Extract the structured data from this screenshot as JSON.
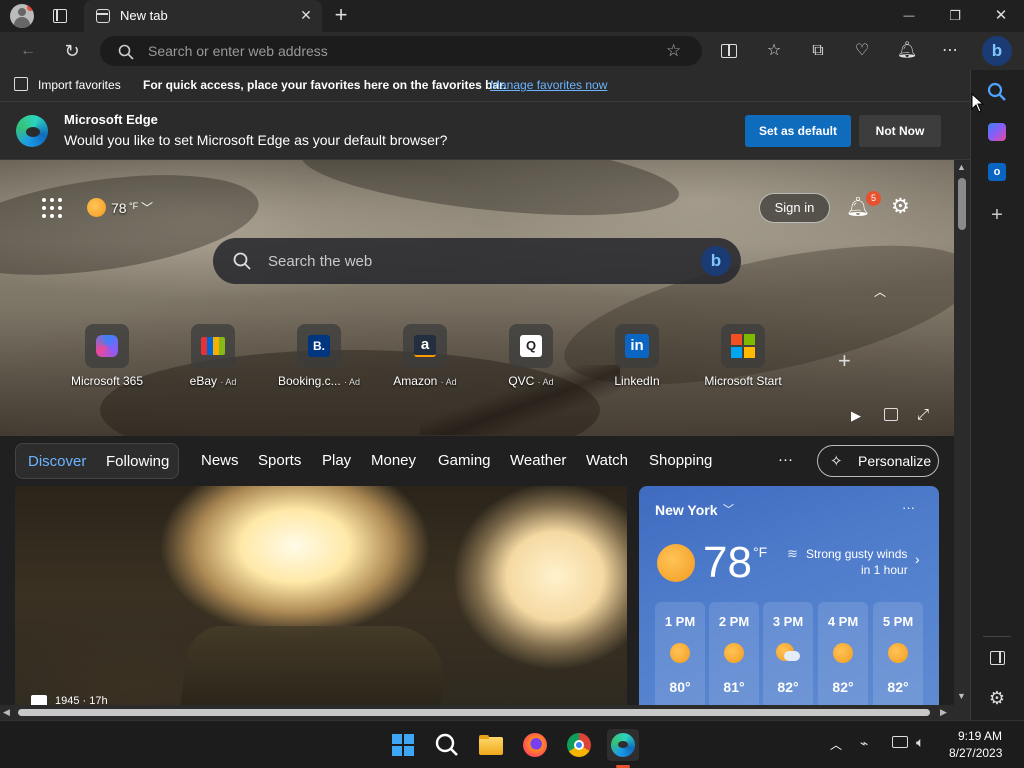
{
  "titlebar": {
    "tab_title": "New tab",
    "tab_close": "✕",
    "new_tab": "+",
    "minimize": "—",
    "maximize": "❐",
    "close": "✕"
  },
  "addressbar": {
    "placeholder": "Search or enter web address"
  },
  "favbar": {
    "import": "Import favorites",
    "message": "For quick access, place your favorites here on the favorites bar.",
    "manage_link": "Manage favorites now"
  },
  "infobar": {
    "title": "Microsoft Edge",
    "question": "Would you like to set Microsoft Edge as your default browser?",
    "set_default": "Set as default",
    "not_now": "Not Now"
  },
  "hero": {
    "weather_temp": "78",
    "weather_unit": "°F",
    "sign_in": "Sign in",
    "notif_count": "5",
    "search_placeholder": "Search the web",
    "quicklinks": [
      {
        "label": "Microsoft 365",
        "ad": ""
      },
      {
        "label": "eBay",
        "ad": "· Ad"
      },
      {
        "label": "Booking.c...",
        "ad": "· Ad"
      },
      {
        "label": "Amazon",
        "ad": "· Ad"
      },
      {
        "label": "QVC",
        "ad": "· Ad"
      },
      {
        "label": "LinkedIn",
        "ad": ""
      },
      {
        "label": "Microsoft Start",
        "ad": ""
      }
    ],
    "tile_glyphs": [
      "B.",
      "a",
      "Q",
      "in"
    ]
  },
  "feednav": {
    "discover": "Discover",
    "following": "Following",
    "items": [
      "News",
      "Sports",
      "Play",
      "Money",
      "Gaming",
      "Weather",
      "Watch",
      "Shopping"
    ],
    "more": "···",
    "personalize": "Personalize"
  },
  "news": {
    "source_time": "1945 · 17h"
  },
  "weather_card": {
    "city": "New York",
    "temp": "78",
    "unit": "°F",
    "alert_line1": "Strong gusty winds",
    "alert_line2": "in 1 hour",
    "more": "···",
    "hours": [
      {
        "time": "1 PM",
        "temp": "80°",
        "icon": "sun"
      },
      {
        "time": "2 PM",
        "temp": "81°",
        "icon": "sun"
      },
      {
        "time": "3 PM",
        "temp": "82°",
        "icon": "partly-cloudy"
      },
      {
        "time": "4 PM",
        "temp": "82°",
        "icon": "sun"
      },
      {
        "time": "5 PM",
        "temp": "82°",
        "icon": "sun"
      }
    ]
  },
  "taskbar": {
    "time": "9:19 AM",
    "date": "8/27/2023"
  },
  "colors": {
    "accent": "#0f6cbd",
    "link": "#6cb4ff",
    "badge": "#e8512e"
  }
}
